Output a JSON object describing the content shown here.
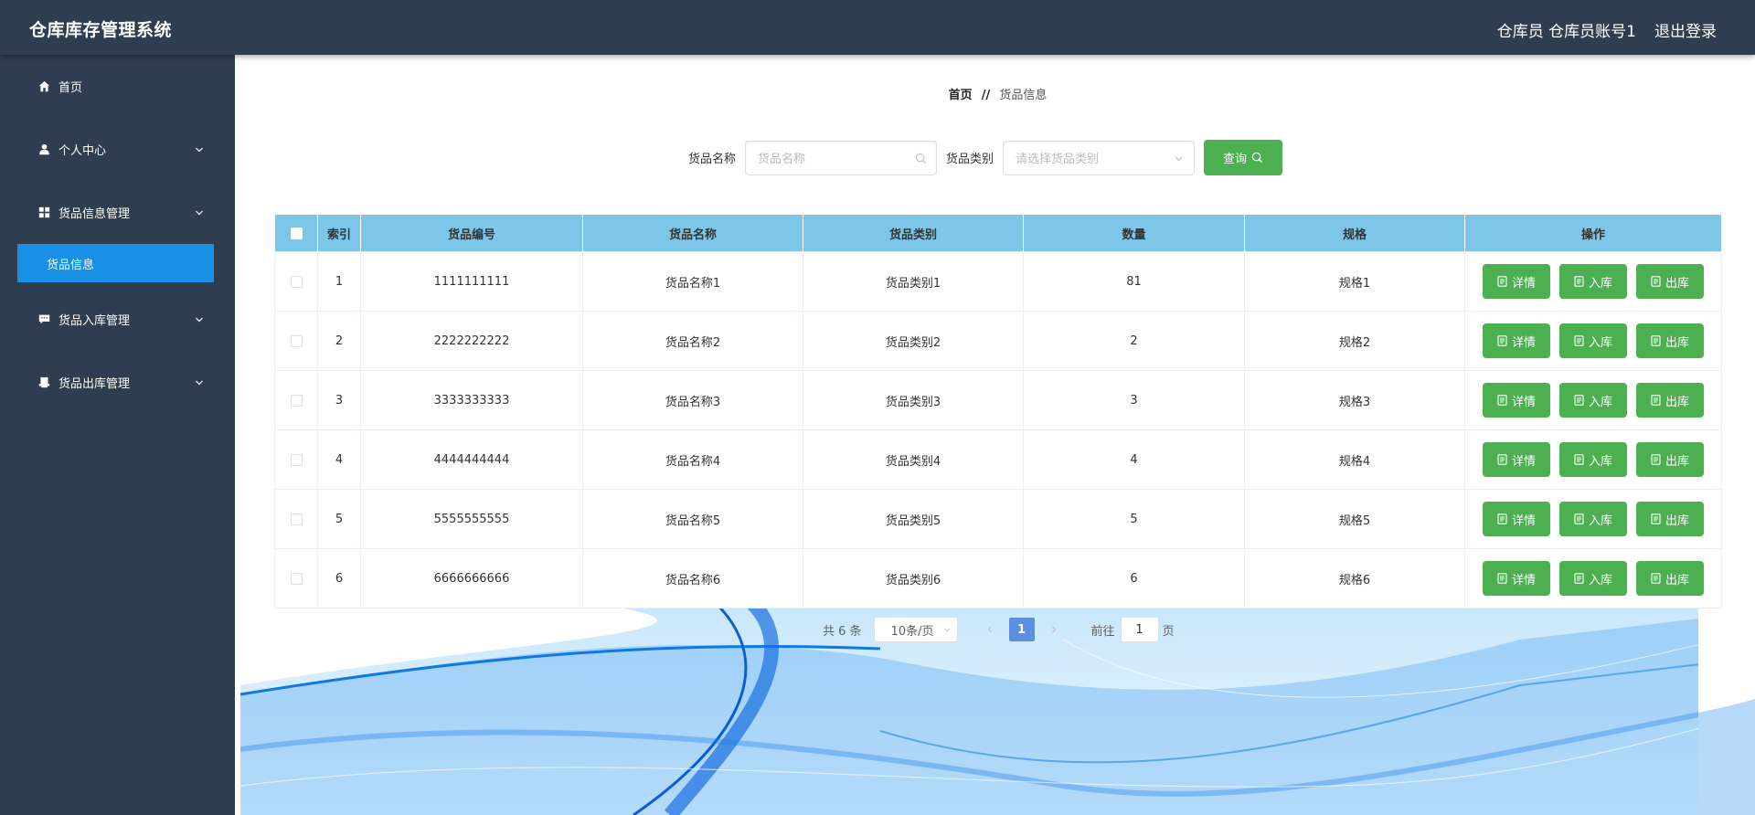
{
  "header": {
    "title": "仓库库存管理系统",
    "role": "仓库员",
    "account": "仓库员账号1",
    "logout": "退出登录"
  },
  "sidebar": {
    "items": [
      {
        "label": "首页",
        "icon": "home-icon",
        "expandable": false
      },
      {
        "label": "个人中心",
        "icon": "user-icon",
        "expandable": true
      },
      {
        "label": "货品信息管理",
        "icon": "grid-icon",
        "expandable": true,
        "children": [
          {
            "label": "货品信息",
            "active": true
          }
        ]
      },
      {
        "label": "货品入库管理",
        "icon": "chat-icon",
        "expandable": true
      },
      {
        "label": "货品出库管理",
        "icon": "printer-icon",
        "expandable": true
      }
    ]
  },
  "breadcrumb": {
    "home": "首页",
    "separator": "//",
    "current": "货品信息"
  },
  "search": {
    "name_label": "货品名称",
    "name_placeholder": "货品名称",
    "category_label": "货品类别",
    "category_placeholder": "请选择货品类别",
    "query_label": "查询"
  },
  "table": {
    "headers": [
      "索引",
      "货品编号",
      "货品名称",
      "货品类别",
      "数量",
      "规格",
      "操作"
    ],
    "rows": [
      {
        "index": "1",
        "code": "1111111111",
        "name": "货品名称1",
        "category": "货品类别1",
        "qty": "81",
        "spec": "规格1"
      },
      {
        "index": "2",
        "code": "2222222222",
        "name": "货品名称2",
        "category": "货品类别2",
        "qty": "2",
        "spec": "规格2"
      },
      {
        "index": "3",
        "code": "3333333333",
        "name": "货品名称3",
        "category": "货品类别3",
        "qty": "3",
        "spec": "规格3"
      },
      {
        "index": "4",
        "code": "4444444444",
        "name": "货品名称4",
        "category": "货品类别4",
        "qty": "4",
        "spec": "规格4"
      },
      {
        "index": "5",
        "code": "5555555555",
        "name": "货品名称5",
        "category": "货品类别5",
        "qty": "5",
        "spec": "规格5"
      },
      {
        "index": "6",
        "code": "6666666666",
        "name": "货品名称6",
        "category": "货品类别6",
        "qty": "6",
        "spec": "规格6"
      }
    ],
    "actions": {
      "detail": "详情",
      "in": "入库",
      "out": "出库"
    }
  },
  "pagination": {
    "total": "共 6 条",
    "page_size": "10条/页",
    "current_page": "1",
    "goto_label": "前往",
    "goto_value": "1",
    "goto_suffix": "页"
  },
  "colors": {
    "header_bg": "#2e3e50",
    "sidebar_active": "#1890e8",
    "table_header": "#7ec6e8",
    "action_button": "#4caf50"
  }
}
